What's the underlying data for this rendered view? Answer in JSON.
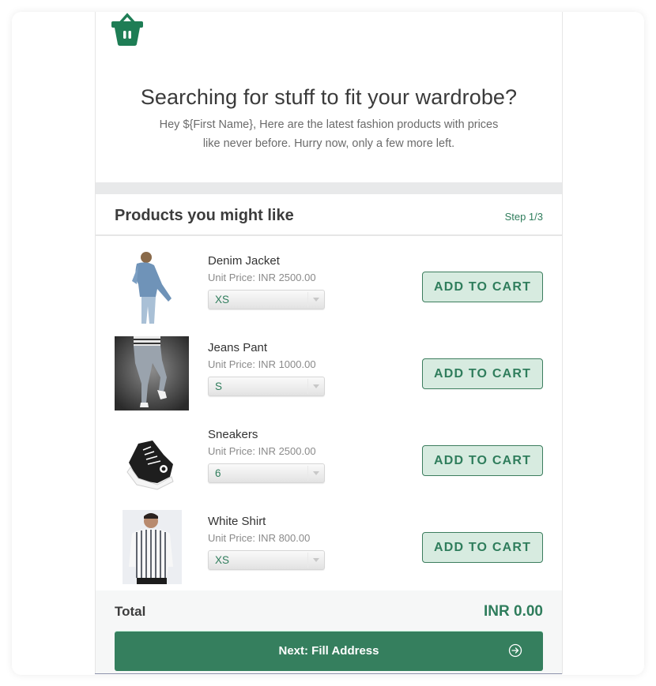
{
  "hero": {
    "icon": "shopping-basket-icon",
    "headline": "Searching for stuff to fit your wardrobe?",
    "intro": "Hey ${First Name}, Here are the latest fashion products with prices like never before. Hurry now, only a few more left."
  },
  "products_section": {
    "title": "Products you might like",
    "step": "Step 1/3"
  },
  "products": [
    {
      "name": "Denim Jacket",
      "price": "Unit Price: INR 2500.00",
      "size": "XS",
      "button": "ADD TO CART",
      "image": "denim-jacket-photo"
    },
    {
      "name": "Jeans Pant",
      "price": "Unit Price: INR 1000.00",
      "size": "S",
      "button": "ADD TO CART",
      "image": "jeans-pant-photo"
    },
    {
      "name": "Sneakers",
      "price": "Unit Price: INR 2500.00",
      "size": "6",
      "button": "ADD TO CART",
      "image": "sneakers-photo"
    },
    {
      "name": "White Shirt",
      "price": "Unit Price: INR 800.00",
      "size": "XS",
      "button": "ADD TO CART",
      "image": "white-shirt-photo"
    }
  ],
  "footer": {
    "total_label": "Total",
    "total_value": "INR 0.00",
    "next_button": "Next: Fill Address",
    "next_icon": "arrow-circle-right-icon"
  },
  "colors": {
    "brand_green": "#357f5e",
    "accent_text": "#2f7d5c",
    "button_tint": "#d7ebe0"
  }
}
